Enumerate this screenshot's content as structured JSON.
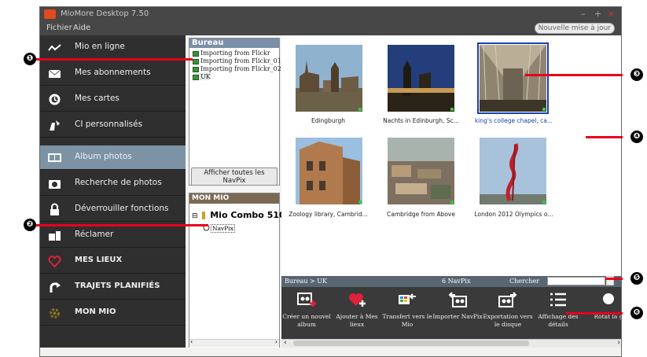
{
  "window": {
    "title": "MioMore Desktop 7.50",
    "controls": [
      "–",
      "+",
      "×"
    ]
  },
  "menu": {
    "items": [
      "Fichier",
      "Aide"
    ],
    "update_button": "Nouvelle mise à jour"
  },
  "sidebar": {
    "items": [
      {
        "label": "Mio en ligne",
        "icon": "signal-icon"
      },
      {
        "label": "Mes abonnements",
        "icon": "envelope-icon"
      },
      {
        "label": "Mes cartes",
        "icon": "globe-icon"
      },
      {
        "label": "CI personnalisés",
        "icon": "custom-poi-icon"
      },
      {
        "label": "Album photos",
        "icon": "photo-album-icon",
        "selected": true
      },
      {
        "label": "Recherche de photos",
        "icon": "camera-icon"
      },
      {
        "label": "Déverrouiller fonctions",
        "icon": "lock-icon"
      },
      {
        "label": "Réclamer",
        "icon": "claim-icon"
      },
      {
        "label": "MES LIEUX",
        "icon": "heart-icon"
      },
      {
        "label": "TRAJETS PLANIFIÉS",
        "icon": "route-icon"
      },
      {
        "label": "MON MIO",
        "icon": "gear-icon"
      }
    ]
  },
  "bureau": {
    "header": "Bureau",
    "items": [
      "Importing from Flickr",
      "Importing from Flickr_01",
      "Importing from Flickr_02",
      "UK"
    ],
    "show_all": "Afficher toutes les NavPix"
  },
  "mon_mio": {
    "header": "MON MIO",
    "device": "Mio Combo 510",
    "device_expander": "⊟",
    "node": "NavPix"
  },
  "gallery": {
    "photos": [
      {
        "caption": "Edingburgh",
        "selected": false
      },
      {
        "caption": "Nachts in Edinburgh, Sc...",
        "selected": false
      },
      {
        "caption": "king's college chapel, ca...",
        "selected": true
      },
      {
        "caption": "Zoology library, Cambrid...",
        "selected": false
      },
      {
        "caption": "Cambridge from Above",
        "selected": false
      },
      {
        "caption": "London 2012 Olympics o...",
        "selected": false
      }
    ]
  },
  "statusbar": {
    "path": "Bureau > UK",
    "count": "6 NavPix",
    "search_label": "Chercher",
    "search_value": ""
  },
  "toolbar": {
    "buttons": [
      {
        "label": "Créer un nouvel album",
        "icon": "new-album-icon"
      },
      {
        "label": "Ajouter à Mes lieux",
        "icon": "add-favorite-icon"
      },
      {
        "label": "Transfert vers le Mio",
        "icon": "transfer-icon"
      },
      {
        "label": "Importer NavPix",
        "icon": "import-icon"
      },
      {
        "label": "Exportation vers le disque",
        "icon": "export-icon"
      },
      {
        "label": "Affichage des détails",
        "icon": "details-list-icon"
      },
      {
        "label": "Rotat la g",
        "icon": "rotate-icon"
      }
    ]
  },
  "callouts": [
    "❶",
    "❷",
    "❸",
    "❹",
    "❺",
    "❻"
  ],
  "colors": {
    "accent_red": "#e8001c",
    "sidebar_bg": "#2f2f2f",
    "sidebar_selected": "#7c93a6",
    "selection_blue": "#1a3fb0"
  }
}
